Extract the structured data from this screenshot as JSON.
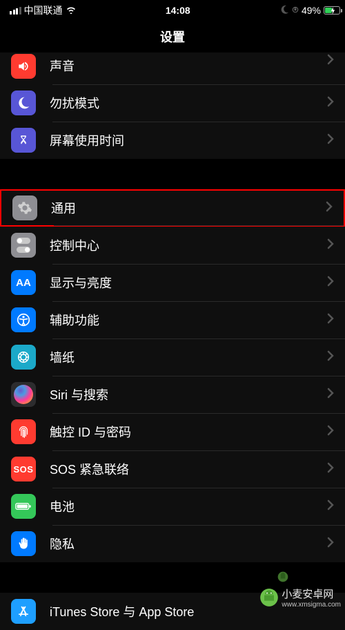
{
  "status_bar": {
    "carrier": "中国联通",
    "time": "14:08",
    "battery_percent": "49%"
  },
  "header": {
    "title": "设置"
  },
  "section1": {
    "items": [
      {
        "id": "sound",
        "label": "声音"
      },
      {
        "id": "dnd",
        "label": "勿扰模式"
      },
      {
        "id": "screentime",
        "label": "屏幕使用时间"
      }
    ]
  },
  "section2": {
    "items": [
      {
        "id": "general",
        "label": "通用",
        "highlighted": true
      },
      {
        "id": "control-center",
        "label": "控制中心"
      },
      {
        "id": "display",
        "label": "显示与亮度"
      },
      {
        "id": "accessibility",
        "label": "辅助功能"
      },
      {
        "id": "wallpaper",
        "label": "墙纸"
      },
      {
        "id": "siri",
        "label": "Siri 与搜索"
      },
      {
        "id": "touchid",
        "label": "触控 ID 与密码"
      },
      {
        "id": "sos",
        "label": "SOS 紧急联络",
        "icon_text": "SOS"
      },
      {
        "id": "battery",
        "label": "电池"
      },
      {
        "id": "privacy",
        "label": "隐私"
      }
    ]
  },
  "section3": {
    "items": [
      {
        "id": "appstore",
        "label": "iTunes Store 与 App Store"
      }
    ]
  },
  "watermark": {
    "text": "小麦安卓网",
    "url": "www.xmsigma.com"
  }
}
